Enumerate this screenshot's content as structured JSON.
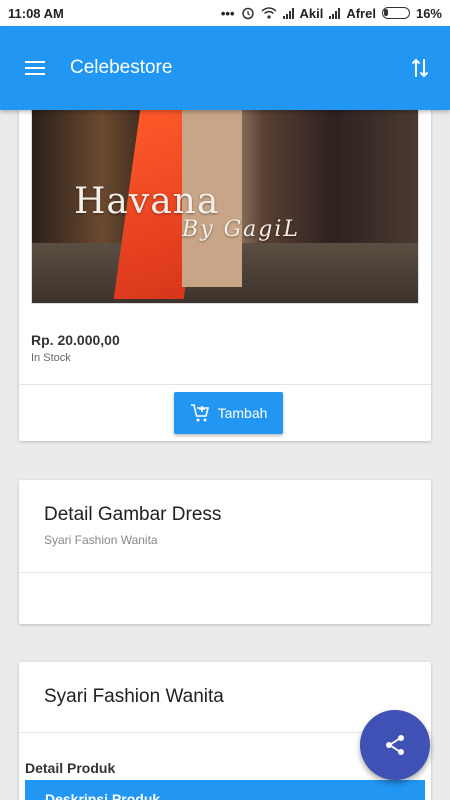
{
  "statusbar": {
    "time": "11:08 AM",
    "dots": "•••",
    "carrier1": "Akil",
    "carrier2": "Afrel",
    "battery": "16%"
  },
  "appbar": {
    "title": "Celebestore",
    "menu_icon": "menu-icon",
    "sort_icon": "sort-icon",
    "color": "#2196f3"
  },
  "product": {
    "image_text_line1": "Havana",
    "image_text_line2": "By GagiL",
    "price": "Rp. 20.000,00",
    "stock": "In Stock",
    "add_button": "Tambah"
  },
  "detail_card": {
    "title": "Detail Gambar Dress",
    "subtitle": "Syari Fashion Wanita"
  },
  "category_card": {
    "title": "Syari Fashion Wanita",
    "detail_label": "Detail Produk",
    "tab_label": "Deskripsi Produk"
  },
  "fab": {
    "icon": "share-icon",
    "color": "#3f51b5"
  }
}
